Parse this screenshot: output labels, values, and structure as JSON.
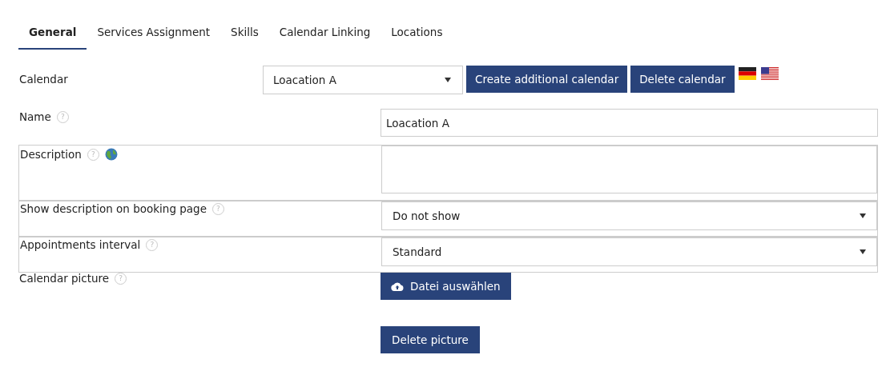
{
  "tabs": [
    {
      "label": "General",
      "selected": true
    },
    {
      "label": "Services Assignment",
      "selected": false
    },
    {
      "label": "Skills",
      "selected": false
    },
    {
      "label": "Calendar Linking",
      "selected": false
    },
    {
      "label": "Locations",
      "selected": false
    }
  ],
  "calendar": {
    "label": "Calendar",
    "value": "Loacation A",
    "buttons": [
      "Create additional calendar",
      "Delete calendar"
    ]
  },
  "fields": [
    {
      "kind": "text",
      "label": "Name",
      "help": "?",
      "translatable": false,
      "value": "Loacation A"
    },
    {
      "kind": "textarea",
      "label": "Description",
      "help": "?",
      "translatable": true
    },
    {
      "kind": "select",
      "label": "Show description on booking page",
      "help": "?",
      "translatable": false,
      "value": "Do not show"
    },
    {
      "kind": "select",
      "label": "Appointments interval",
      "help": "?",
      "translatable": false,
      "value": "Standard"
    },
    {
      "kind": "file",
      "label": "Calendar picture",
      "help": "?",
      "translatable": false,
      "button": "Datei auswählen",
      "delete_button": "Delete picture"
    }
  ]
}
